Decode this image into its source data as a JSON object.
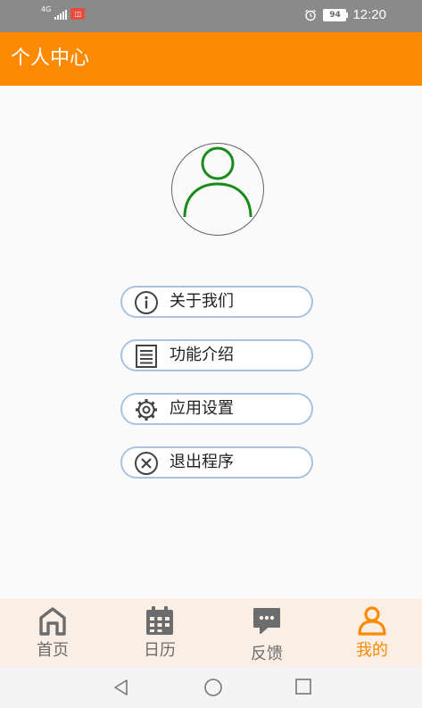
{
  "status_bar": {
    "network_label": "4G",
    "time": "12:20",
    "battery": "94"
  },
  "app_bar": {
    "title": "个人中心"
  },
  "menu": {
    "items": [
      {
        "label": "关于我们",
        "icon": "info-icon"
      },
      {
        "label": "功能介绍",
        "icon": "document-list-icon"
      },
      {
        "label": "应用设置",
        "icon": "gear-icon"
      },
      {
        "label": "退出程序",
        "icon": "close-circle-icon"
      }
    ]
  },
  "bottom_nav": {
    "items": [
      {
        "label": "首页",
        "icon": "home-icon"
      },
      {
        "label": "日历",
        "icon": "calendar-icon"
      },
      {
        "label": "反馈",
        "icon": "chat-bubble-icon"
      },
      {
        "label": "我的",
        "icon": "person-icon",
        "active": true
      }
    ]
  },
  "colors": {
    "accent": "#fd8a00",
    "avatar_stroke": "#1a8a1a",
    "button_border": "#a9c2e2",
    "nav_background": "#fbefe5"
  }
}
